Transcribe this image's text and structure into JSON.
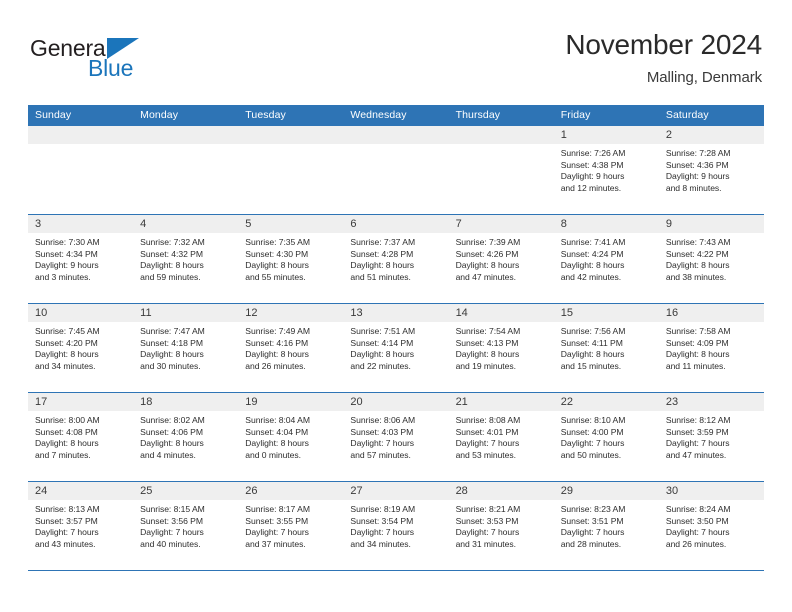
{
  "brand": {
    "name_part1": "General",
    "name_part2": "Blue",
    "triangle_color": "#1b75bb"
  },
  "header": {
    "title": "November 2024",
    "subtitle": "Malling, Denmark"
  },
  "theme": {
    "header_blue": "#2e74b5",
    "daynum_bg": "#efefef",
    "text": "#2e2e2e"
  },
  "weekdays": [
    "Sunday",
    "Monday",
    "Tuesday",
    "Wednesday",
    "Thursday",
    "Friday",
    "Saturday"
  ],
  "labels": {
    "sunrise": "Sunrise:",
    "sunset": "Sunset:",
    "daylight": "Daylight:"
  },
  "weeks": [
    [
      {
        "day": "",
        "blank": true
      },
      {
        "day": "",
        "blank": true
      },
      {
        "day": "",
        "blank": true
      },
      {
        "day": "",
        "blank": true
      },
      {
        "day": "",
        "blank": true
      },
      {
        "day": "1",
        "sunrise": "Sunrise: 7:26 AM",
        "sunset": "Sunset: 4:38 PM",
        "daylight_1": "Daylight: 9 hours",
        "daylight_2": "and 12 minutes."
      },
      {
        "day": "2",
        "sunrise": "Sunrise: 7:28 AM",
        "sunset": "Sunset: 4:36 PM",
        "daylight_1": "Daylight: 9 hours",
        "daylight_2": "and 8 minutes."
      }
    ],
    [
      {
        "day": "3",
        "sunrise": "Sunrise: 7:30 AM",
        "sunset": "Sunset: 4:34 PM",
        "daylight_1": "Daylight: 9 hours",
        "daylight_2": "and 3 minutes."
      },
      {
        "day": "4",
        "sunrise": "Sunrise: 7:32 AM",
        "sunset": "Sunset: 4:32 PM",
        "daylight_1": "Daylight: 8 hours",
        "daylight_2": "and 59 minutes."
      },
      {
        "day": "5",
        "sunrise": "Sunrise: 7:35 AM",
        "sunset": "Sunset: 4:30 PM",
        "daylight_1": "Daylight: 8 hours",
        "daylight_2": "and 55 minutes."
      },
      {
        "day": "6",
        "sunrise": "Sunrise: 7:37 AM",
        "sunset": "Sunset: 4:28 PM",
        "daylight_1": "Daylight: 8 hours",
        "daylight_2": "and 51 minutes."
      },
      {
        "day": "7",
        "sunrise": "Sunrise: 7:39 AM",
        "sunset": "Sunset: 4:26 PM",
        "daylight_1": "Daylight: 8 hours",
        "daylight_2": "and 47 minutes."
      },
      {
        "day": "8",
        "sunrise": "Sunrise: 7:41 AM",
        "sunset": "Sunset: 4:24 PM",
        "daylight_1": "Daylight: 8 hours",
        "daylight_2": "and 42 minutes."
      },
      {
        "day": "9",
        "sunrise": "Sunrise: 7:43 AM",
        "sunset": "Sunset: 4:22 PM",
        "daylight_1": "Daylight: 8 hours",
        "daylight_2": "and 38 minutes."
      }
    ],
    [
      {
        "day": "10",
        "sunrise": "Sunrise: 7:45 AM",
        "sunset": "Sunset: 4:20 PM",
        "daylight_1": "Daylight: 8 hours",
        "daylight_2": "and 34 minutes."
      },
      {
        "day": "11",
        "sunrise": "Sunrise: 7:47 AM",
        "sunset": "Sunset: 4:18 PM",
        "daylight_1": "Daylight: 8 hours",
        "daylight_2": "and 30 minutes."
      },
      {
        "day": "12",
        "sunrise": "Sunrise: 7:49 AM",
        "sunset": "Sunset: 4:16 PM",
        "daylight_1": "Daylight: 8 hours",
        "daylight_2": "and 26 minutes."
      },
      {
        "day": "13",
        "sunrise": "Sunrise: 7:51 AM",
        "sunset": "Sunset: 4:14 PM",
        "daylight_1": "Daylight: 8 hours",
        "daylight_2": "and 22 minutes."
      },
      {
        "day": "14",
        "sunrise": "Sunrise: 7:54 AM",
        "sunset": "Sunset: 4:13 PM",
        "daylight_1": "Daylight: 8 hours",
        "daylight_2": "and 19 minutes."
      },
      {
        "day": "15",
        "sunrise": "Sunrise: 7:56 AM",
        "sunset": "Sunset: 4:11 PM",
        "daylight_1": "Daylight: 8 hours",
        "daylight_2": "and 15 minutes."
      },
      {
        "day": "16",
        "sunrise": "Sunrise: 7:58 AM",
        "sunset": "Sunset: 4:09 PM",
        "daylight_1": "Daylight: 8 hours",
        "daylight_2": "and 11 minutes."
      }
    ],
    [
      {
        "day": "17",
        "sunrise": "Sunrise: 8:00 AM",
        "sunset": "Sunset: 4:08 PM",
        "daylight_1": "Daylight: 8 hours",
        "daylight_2": "and 7 minutes."
      },
      {
        "day": "18",
        "sunrise": "Sunrise: 8:02 AM",
        "sunset": "Sunset: 4:06 PM",
        "daylight_1": "Daylight: 8 hours",
        "daylight_2": "and 4 minutes."
      },
      {
        "day": "19",
        "sunrise": "Sunrise: 8:04 AM",
        "sunset": "Sunset: 4:04 PM",
        "daylight_1": "Daylight: 8 hours",
        "daylight_2": "and 0 minutes."
      },
      {
        "day": "20",
        "sunrise": "Sunrise: 8:06 AM",
        "sunset": "Sunset: 4:03 PM",
        "daylight_1": "Daylight: 7 hours",
        "daylight_2": "and 57 minutes."
      },
      {
        "day": "21",
        "sunrise": "Sunrise: 8:08 AM",
        "sunset": "Sunset: 4:01 PM",
        "daylight_1": "Daylight: 7 hours",
        "daylight_2": "and 53 minutes."
      },
      {
        "day": "22",
        "sunrise": "Sunrise: 8:10 AM",
        "sunset": "Sunset: 4:00 PM",
        "daylight_1": "Daylight: 7 hours",
        "daylight_2": "and 50 minutes."
      },
      {
        "day": "23",
        "sunrise": "Sunrise: 8:12 AM",
        "sunset": "Sunset: 3:59 PM",
        "daylight_1": "Daylight: 7 hours",
        "daylight_2": "and 47 minutes."
      }
    ],
    [
      {
        "day": "24",
        "sunrise": "Sunrise: 8:13 AM",
        "sunset": "Sunset: 3:57 PM",
        "daylight_1": "Daylight: 7 hours",
        "daylight_2": "and 43 minutes."
      },
      {
        "day": "25",
        "sunrise": "Sunrise: 8:15 AM",
        "sunset": "Sunset: 3:56 PM",
        "daylight_1": "Daylight: 7 hours",
        "daylight_2": "and 40 minutes."
      },
      {
        "day": "26",
        "sunrise": "Sunrise: 8:17 AM",
        "sunset": "Sunset: 3:55 PM",
        "daylight_1": "Daylight: 7 hours",
        "daylight_2": "and 37 minutes."
      },
      {
        "day": "27",
        "sunrise": "Sunrise: 8:19 AM",
        "sunset": "Sunset: 3:54 PM",
        "daylight_1": "Daylight: 7 hours",
        "daylight_2": "and 34 minutes."
      },
      {
        "day": "28",
        "sunrise": "Sunrise: 8:21 AM",
        "sunset": "Sunset: 3:53 PM",
        "daylight_1": "Daylight: 7 hours",
        "daylight_2": "and 31 minutes."
      },
      {
        "day": "29",
        "sunrise": "Sunrise: 8:23 AM",
        "sunset": "Sunset: 3:51 PM",
        "daylight_1": "Daylight: 7 hours",
        "daylight_2": "and 28 minutes."
      },
      {
        "day": "30",
        "sunrise": "Sunrise: 8:24 AM",
        "sunset": "Sunset: 3:50 PM",
        "daylight_1": "Daylight: 7 hours",
        "daylight_2": "and 26 minutes."
      }
    ]
  ]
}
